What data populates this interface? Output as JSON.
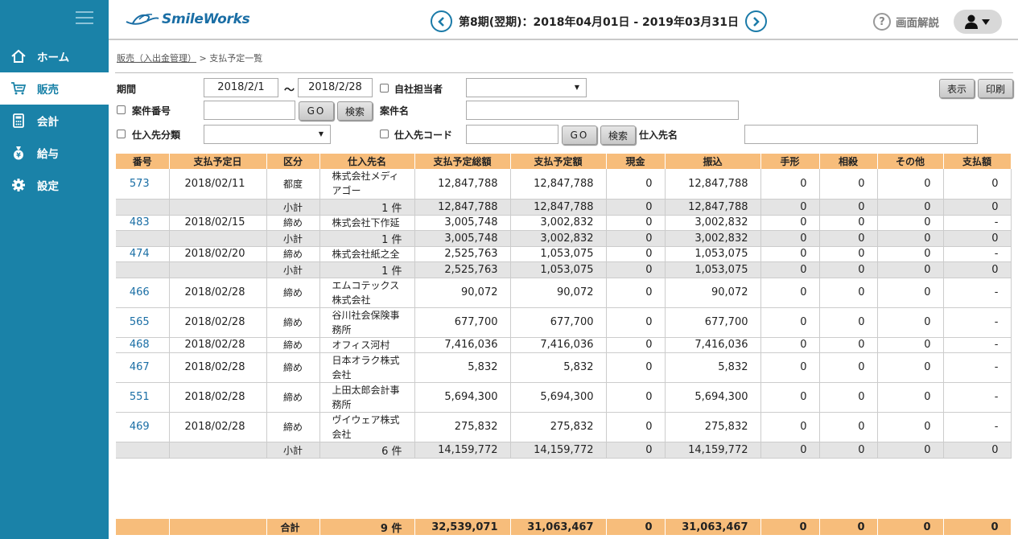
{
  "app": {
    "logo_text": "SmileWorks"
  },
  "nav": [
    {
      "label": "ホーム",
      "icon": "home-icon"
    },
    {
      "label": "販売",
      "icon": "cart-icon"
    },
    {
      "label": "会計",
      "icon": "calculator-icon"
    },
    {
      "label": "給与",
      "icon": "money-bag-icon"
    },
    {
      "label": "設定",
      "icon": "gear-icon"
    }
  ],
  "header": {
    "period": "第8期(翌期)：2018年04月01日 - 2019年03月31日",
    "help_label": "画面解説"
  },
  "breadcrumb": {
    "parent": "販売（入出金管理）",
    "sep": ">",
    "current": "支払予定一覧"
  },
  "filters": {
    "period_label": "期間",
    "date_from": "2018/2/1",
    "tilde": "〜",
    "date_to": "2018/2/28",
    "staff_label": "自社担当者",
    "case_no_label": "案件番号",
    "go_label": "GO",
    "search_label": "検索",
    "case_name_label": "案件名",
    "supplier_class_label": "仕入先分類",
    "supplier_code_label": "仕入先コード",
    "supplier_name_label": "仕入先名",
    "show_label": "表示",
    "print_label": "印刷"
  },
  "table": {
    "headers": [
      "番号",
      "支払予定日",
      "区分",
      "仕入先名",
      "支払予定総額",
      "支払予定額",
      "現金",
      "振込",
      "手形",
      "相殺",
      "その他",
      "支払額"
    ],
    "rows": [
      {
        "type": "data",
        "tall": true,
        "no": "573",
        "date": "2018/02/11",
        "kubun": "都度",
        "name": "株式会社メディアゴー",
        "total": "12,847,788",
        "planned": "12,847,788",
        "cash": "0",
        "transfer": "12,847,788",
        "bill": "0",
        "offset": "0",
        "other": "0",
        "paid": "0"
      },
      {
        "type": "sub",
        "kubun": "小計",
        "name": "1 件",
        "total": "12,847,788",
        "planned": "12,847,788",
        "cash": "0",
        "transfer": "12,847,788",
        "bill": "0",
        "offset": "0",
        "other": "0",
        "paid": "0"
      },
      {
        "type": "data",
        "tall": false,
        "no": "483",
        "date": "2018/02/15",
        "kubun": "締め",
        "name": "株式会社下作延",
        "total": "3,005,748",
        "planned": "3,002,832",
        "cash": "0",
        "transfer": "3,002,832",
        "bill": "0",
        "offset": "0",
        "other": "0",
        "paid": "-"
      },
      {
        "type": "sub",
        "kubun": "小計",
        "name": "1 件",
        "total": "3,005,748",
        "planned": "3,002,832",
        "cash": "0",
        "transfer": "3,002,832",
        "bill": "0",
        "offset": "0",
        "other": "0",
        "paid": "0"
      },
      {
        "type": "data",
        "tall": false,
        "no": "474",
        "date": "2018/02/20",
        "kubun": "締め",
        "name": "株式会社紙之全",
        "total": "2,525,763",
        "planned": "1,053,075",
        "cash": "0",
        "transfer": "1,053,075",
        "bill": "0",
        "offset": "0",
        "other": "0",
        "paid": "-"
      },
      {
        "type": "sub",
        "kubun": "小計",
        "name": "1 件",
        "total": "2,525,763",
        "planned": "1,053,075",
        "cash": "0",
        "transfer": "1,053,075",
        "bill": "0",
        "offset": "0",
        "other": "0",
        "paid": "0"
      },
      {
        "type": "data",
        "tall": true,
        "no": "466",
        "date": "2018/02/28",
        "kubun": "締め",
        "name": "エムコテックス株式会社",
        "total": "90,072",
        "planned": "90,072",
        "cash": "0",
        "transfer": "90,072",
        "bill": "0",
        "offset": "0",
        "other": "0",
        "paid": "-"
      },
      {
        "type": "data",
        "tall": true,
        "no": "565",
        "date": "2018/02/28",
        "kubun": "締め",
        "name": "谷川社会保険事務所",
        "total": "677,700",
        "planned": "677,700",
        "cash": "0",
        "transfer": "677,700",
        "bill": "0",
        "offset": "0",
        "other": "0",
        "paid": "-"
      },
      {
        "type": "data",
        "tall": false,
        "no": "468",
        "date": "2018/02/28",
        "kubun": "締め",
        "name": "オフィス河村",
        "total": "7,416,036",
        "planned": "7,416,036",
        "cash": "0",
        "transfer": "7,416,036",
        "bill": "0",
        "offset": "0",
        "other": "0",
        "paid": "-"
      },
      {
        "type": "data",
        "tall": true,
        "no": "467",
        "date": "2018/02/28",
        "kubun": "締め",
        "name": "日本オラク株式会社",
        "total": "5,832",
        "planned": "5,832",
        "cash": "0",
        "transfer": "5,832",
        "bill": "0",
        "offset": "0",
        "other": "0",
        "paid": "-"
      },
      {
        "type": "data",
        "tall": true,
        "no": "551",
        "date": "2018/02/28",
        "kubun": "締め",
        "name": "上田太郎会計事務所",
        "total": "5,694,300",
        "planned": "5,694,300",
        "cash": "0",
        "transfer": "5,694,300",
        "bill": "0",
        "offset": "0",
        "other": "0",
        "paid": "-"
      },
      {
        "type": "data",
        "tall": true,
        "no": "469",
        "date": "2018/02/28",
        "kubun": "締め",
        "name": "ヴイウェア株式会社",
        "total": "275,832",
        "planned": "275,832",
        "cash": "0",
        "transfer": "275,832",
        "bill": "0",
        "offset": "0",
        "other": "0",
        "paid": "-"
      },
      {
        "type": "sub",
        "kubun": "小計",
        "name": "6 件",
        "total": "14,159,772",
        "planned": "14,159,772",
        "cash": "0",
        "transfer": "14,159,772",
        "bill": "0",
        "offset": "0",
        "other": "0",
        "paid": "0"
      }
    ],
    "grand_total": {
      "kubun": "合計",
      "name": "9 件",
      "total": "32,539,071",
      "planned": "31,063,467",
      "cash": "0",
      "transfer": "31,063,467",
      "bill": "0",
      "offset": "0",
      "other": "0",
      "paid": "0"
    }
  },
  "colors": {
    "sidebar": "#1a82a8",
    "table_header": "#f7bd7b",
    "subtotal_row": "#e4e4e4",
    "link": "#1a6ea5"
  }
}
